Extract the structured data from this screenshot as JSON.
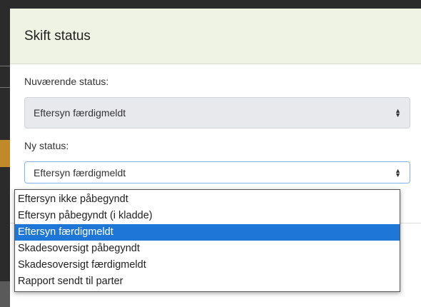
{
  "modal": {
    "title": "Skift status",
    "current_status_label": "Nuværende status:",
    "current_status_value": "Eftersyn færdigmeldt",
    "new_status_label": "Ny status:",
    "new_status_value": "Eftersyn færdigmeldt"
  },
  "dropdown": {
    "options": [
      "Eftersyn ikke påbegyndt",
      "Eftersyn påbegyndt (i kladde)",
      "Eftersyn færdigmeldt",
      "Skadesoversigt påbegyndt",
      "Skadesoversigt færdigmeldt",
      "Rapport sendt til parter"
    ],
    "selected_index": 2
  },
  "colors": {
    "header_bg": "#eef3e4",
    "selected_bg": "#1e76d6",
    "focus_border": "#7fb4ea"
  }
}
